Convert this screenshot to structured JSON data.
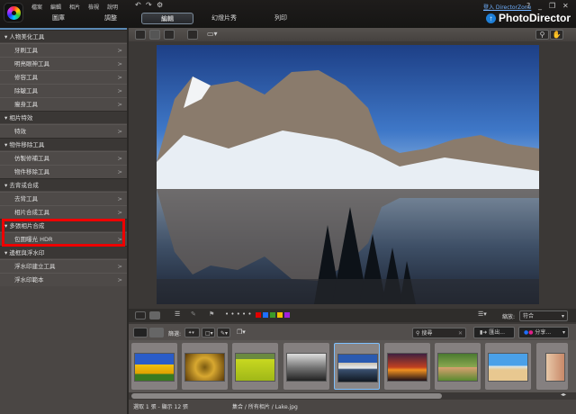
{
  "menu": [
    "檔案",
    "編輯",
    "相片",
    "檢視",
    "說明"
  ],
  "tabs": [
    "圖庫",
    "調整",
    "編輯",
    "幻燈片秀",
    "列印"
  ],
  "active_tab": "編輯",
  "signin": "登入 DirectorZone",
  "window_buttons": [
    "?",
    "_",
    "❐",
    "✕"
  ],
  "brand": "PhotoDirector",
  "sidebar": {
    "groups": [
      {
        "title": "人物美化工具",
        "items": [
          "牙刷工具",
          "明亮眼神工具",
          "修容工具",
          "除皺工具",
          "瘦身工具"
        ]
      },
      {
        "title": "相片特效",
        "items": [
          "特效"
        ]
      },
      {
        "title": "物件移除工具",
        "items": [
          "仿製修補工具",
          "物件移除工具"
        ]
      },
      {
        "title": "去背或合成",
        "items": [
          "去背工具",
          "相片合成工具"
        ]
      },
      {
        "title": "多張相片合成",
        "items": [
          "包圍曝光 HDR"
        ]
      },
      {
        "title": "邊框與浮水印",
        "items": [
          "浮水印建立工具",
          "浮水印範本"
        ]
      }
    ],
    "highlighted": "多張相片合成"
  },
  "viewer": {
    "zoom_label": "縮放:",
    "zoom_value": "符合",
    "colors": [
      "#e00000",
      "#1e6fff",
      "#3a9a2a",
      "#f0c000",
      "#a020e0"
    ],
    "dots": "• • • • •"
  },
  "filmstrip": {
    "filter_label": "篩選:",
    "search_placeholder": "搜尋",
    "export_label": "匯出...",
    "share_label": "分享...",
    "selected_index": 4,
    "thumbs": [
      "sunflower",
      "spiral",
      "bicycle-field",
      "bw-landscape",
      "lake",
      "sunset",
      "cat",
      "beach",
      "portrait"
    ]
  },
  "status": {
    "selection": "選取 1 張 - 顯示 12 張",
    "path": "集合 / 所有相片 / Lake.jpg"
  }
}
